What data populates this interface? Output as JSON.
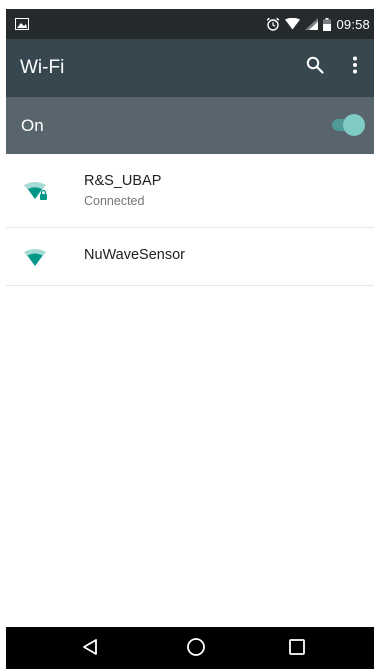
{
  "status_bar": {
    "time": "09:58",
    "icons": [
      "image-notification-icon",
      "alarm-icon",
      "wifi-signal-icon",
      "cell-signal-icon",
      "battery-icon"
    ]
  },
  "toolbar": {
    "title": "Wi-Fi",
    "search_icon": "search-icon",
    "more_icon": "more-vert-icon"
  },
  "master_switch": {
    "label": "On",
    "checked": true
  },
  "networks": [
    {
      "name": "R&S_UBAP",
      "status": "Connected",
      "secured": true
    },
    {
      "name": "NuWaveSensor",
      "status": "",
      "secured": false
    }
  ],
  "nav_bar": {
    "buttons": [
      "back-icon",
      "home-icon",
      "recents-icon"
    ]
  },
  "colors": {
    "status_bar": "#252a2d",
    "toolbar": "#37474f",
    "switch_bar": "#58656d",
    "accent": "#009688",
    "toggle_thumb": "#80cbc4",
    "nav_bar": "#000000"
  }
}
